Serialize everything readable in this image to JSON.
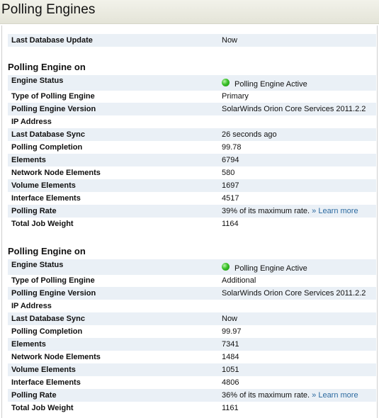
{
  "page": {
    "title": "Polling Engines"
  },
  "summary": {
    "label": "Last Database Update",
    "value": "Now"
  },
  "engines": [
    {
      "section_title": "Polling Engine on",
      "status_label": "Engine Status",
      "status_value": "Polling Engine Active",
      "status_color": "#33bb22",
      "type_label": "Type of Polling Engine",
      "type_value": "Primary",
      "version_label": "Polling Engine Version",
      "version_value": "SolarWinds Orion Core Services 2011.2.2",
      "ip_label": "IP Address",
      "ip_value": "",
      "sync_label": "Last Database Sync",
      "sync_value": "26 seconds ago",
      "completion_label": "Polling Completion",
      "completion_value": "99.78",
      "elements_label": "Elements",
      "elements_value": "6794",
      "node_label": "Network Node Elements",
      "node_value": "580",
      "volume_label": "Volume Elements",
      "volume_value": "1697",
      "interface_label": "Interface Elements",
      "interface_value": "4517",
      "rate_label": "Polling Rate",
      "rate_value": "39% of its maximum rate.",
      "rate_link": "» Learn more",
      "weight_label": "Total Job Weight",
      "weight_value": "1164"
    },
    {
      "section_title": "Polling Engine on",
      "status_label": "Engine Status",
      "status_value": "Polling Engine Active",
      "status_color": "#33bb22",
      "type_label": "Type of Polling Engine",
      "type_value": "Additional",
      "version_label": "Polling Engine Version",
      "version_value": "SolarWinds Orion Core Services 2011.2.2",
      "ip_label": "IP Address",
      "ip_value": "",
      "sync_label": "Last Database Sync",
      "sync_value": "Now",
      "completion_label": "Polling Completion",
      "completion_value": "99.97",
      "elements_label": "Elements",
      "elements_value": "7341",
      "node_label": "Network Node Elements",
      "node_value": "1484",
      "volume_label": "Volume Elements",
      "volume_value": "1051",
      "interface_label": "Interface Elements",
      "interface_value": "4806",
      "rate_label": "Polling Rate",
      "rate_value": "36% of its maximum rate.",
      "rate_link": "» Learn more",
      "weight_label": "Total Job Weight",
      "weight_value": "1161"
    }
  ]
}
